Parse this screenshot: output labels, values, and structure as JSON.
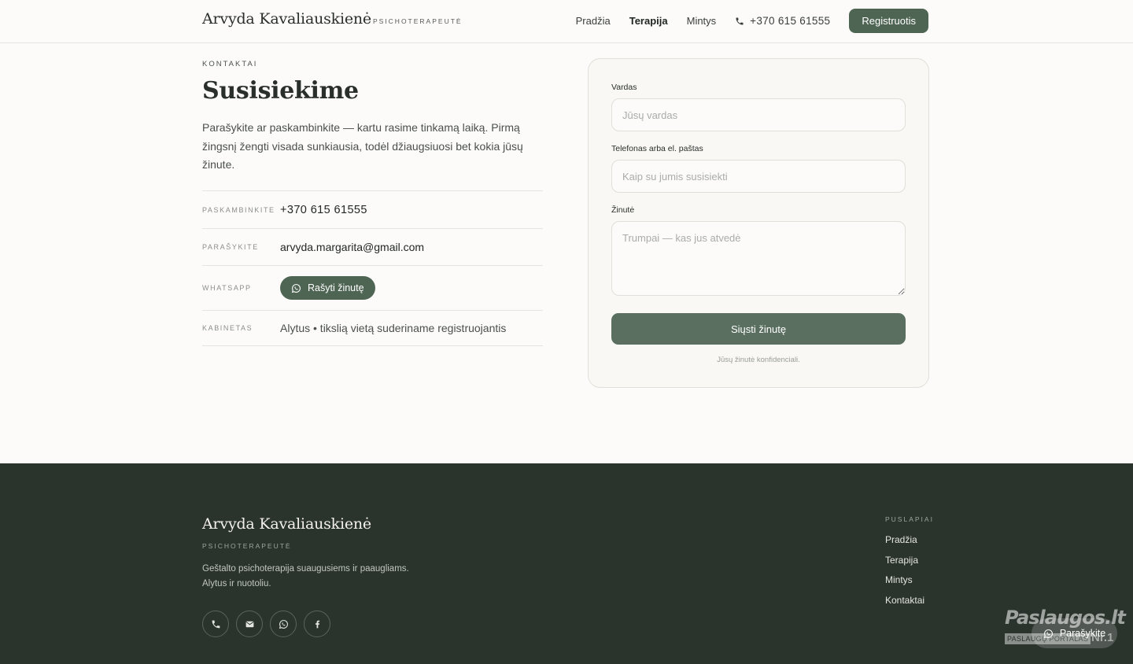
{
  "header": {
    "brand_name": "Arvyda Kavaliauskienė",
    "brand_sub": "PSICHOTERAPEUTĖ",
    "nav": [
      {
        "label": "Pradžia",
        "active": false
      },
      {
        "label": "Terapija",
        "active": true
      },
      {
        "label": "Mintys",
        "active": false
      }
    ],
    "phone": "+370 615 61555",
    "register_label": "Registruotis"
  },
  "contact": {
    "eyebrow": "KONTAKTAI",
    "title": "Susisiekime",
    "intro": "Parašykite ar paskambinkite — kartu rasime tinkamą laiką. Pirmą žingsnį žengti visada sunkiausia, todėl džiaugsiuosi bet kokia jūsų žinute.",
    "rows": [
      {
        "label": "PASKAMBINKITE",
        "value": "+370 615 61555"
      },
      {
        "label": "PARAŠYKITE",
        "value": "arvyda.margarita@gmail.com"
      },
      {
        "label": "WHATSAPP",
        "value": "Rašyti žinutę"
      },
      {
        "label": "KABINETAS",
        "value": "Alytus • tikslią vietą suderiname registruojantis"
      }
    ]
  },
  "form": {
    "name_label": "Vardas",
    "name_placeholder": "Jūsų vardas",
    "contact_label": "Telefonas arba el. paštas",
    "contact_placeholder": "Kaip su jumis susisiekti",
    "message_label": "Žinutė",
    "message_placeholder": "Trumpai — kas jus atvedė",
    "submit_label": "Siųsti žinutę",
    "note": "Jūsų žinutė konfidenciali."
  },
  "footer": {
    "brand_name": "Arvyda Kavaliauskienė",
    "brand_sub": "PSICHOTERAPEUTĖ",
    "desc_line1": "Geštalto psichoterapija suaugusiems ir paaugliams.",
    "desc_line2": "Alytus ir nuotoliu.",
    "socials": [
      "phone-icon",
      "mail-icon",
      "whatsapp-icon",
      "facebook-icon"
    ],
    "pages_title": "PUSLAPIAI",
    "pages": [
      "Pradžia",
      "Terapija",
      "Mintys",
      "Kontaktai"
    ]
  },
  "floating": {
    "whatsapp_label": "Parašykite"
  },
  "watermark": {
    "brand": "Paslaugos.lt",
    "tagline": "PASLAUGŲ PORTALAS",
    "badge": "Nr.1"
  },
  "colors": {
    "accent": "#4f6554",
    "footer_bg": "#2b332d",
    "page_bg": "#fcfbf9"
  }
}
